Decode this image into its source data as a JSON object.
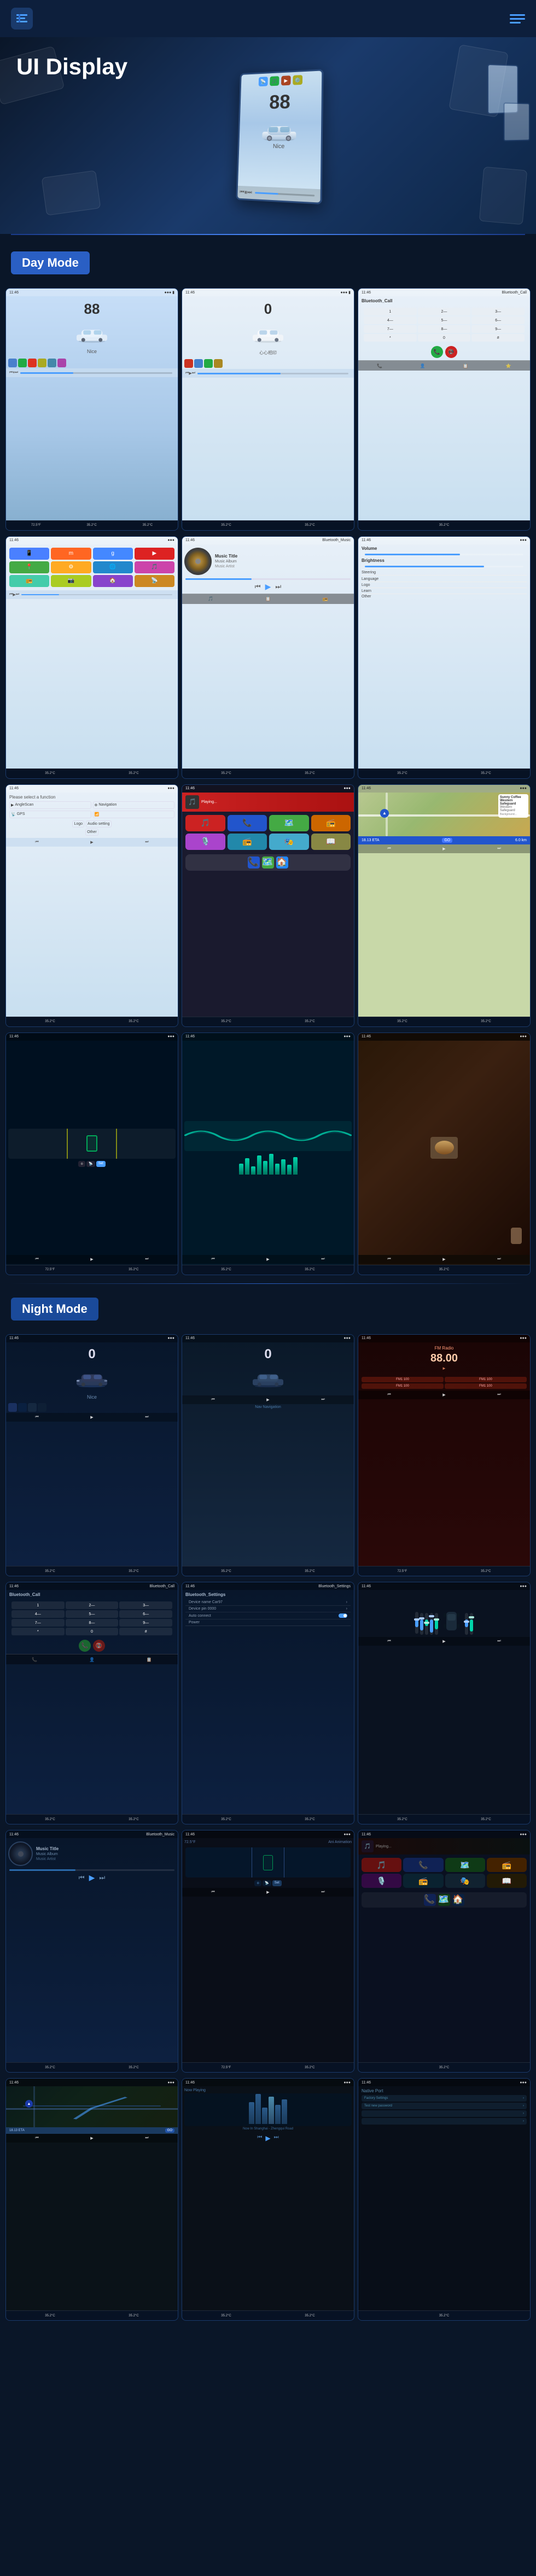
{
  "header": {
    "logo_symbol": "☰",
    "menu_symbol": "≡",
    "title": "UI Display"
  },
  "hero": {
    "title": "UI Display",
    "device_number": "88",
    "device_label": "Nice"
  },
  "day_mode": {
    "badge": "Day Mode",
    "screens": [
      {
        "id": "day-1",
        "type": "main-blue",
        "number": "88",
        "label": "Nice"
      },
      {
        "id": "day-2",
        "type": "main-white",
        "number": "0"
      },
      {
        "id": "day-3",
        "type": "phone-dial"
      },
      {
        "id": "day-4",
        "type": "app-launcher"
      },
      {
        "id": "day-5",
        "type": "music-blue"
      },
      {
        "id": "day-6",
        "type": "settings-panel"
      },
      {
        "id": "day-7",
        "type": "driver-assist"
      },
      {
        "id": "day-8",
        "type": "carplay"
      },
      {
        "id": "day-9",
        "type": "nav-map"
      },
      {
        "id": "day-10",
        "type": "eq-dark"
      },
      {
        "id": "day-11",
        "type": "eq-wave"
      },
      {
        "id": "day-12",
        "type": "video-play"
      }
    ]
  },
  "night_mode": {
    "badge": "Night Mode",
    "screens": [
      {
        "id": "night-1",
        "type": "night-main",
        "number": "0"
      },
      {
        "id": "night-2",
        "type": "night-car"
      },
      {
        "id": "night-3",
        "type": "night-radio",
        "number": "88.00"
      },
      {
        "id": "night-4",
        "type": "night-phone"
      },
      {
        "id": "night-5",
        "type": "night-settings"
      },
      {
        "id": "night-6",
        "type": "night-eq"
      },
      {
        "id": "night-7",
        "type": "night-music"
      },
      {
        "id": "night-8",
        "type": "night-assist"
      },
      {
        "id": "night-9",
        "type": "night-carplay"
      },
      {
        "id": "night-10",
        "type": "night-nav"
      },
      {
        "id": "night-11",
        "type": "night-build"
      },
      {
        "id": "night-12",
        "type": "night-list"
      }
    ]
  },
  "status": {
    "time": "11:46",
    "temp_left": "72.5°F",
    "temp_right": "35.2°C",
    "temp_right2": "35.2°C",
    "signal": "●●●",
    "battery": "▮▮▮"
  },
  "temperatures": {
    "left": "72.5°F",
    "mid": "35.2°C",
    "right": "35.2°C"
  },
  "playback": {
    "play": "▶",
    "pause": "⏸",
    "prev": "⏮",
    "next": "⏭",
    "back": "⏪",
    "forward": "⏩"
  },
  "music": {
    "title": "Music Title",
    "album": "Music Album",
    "artist": "Music Artist"
  },
  "phone": {
    "keys": [
      "1",
      "2—",
      "3—",
      "4—",
      "5—",
      "6—",
      "7—",
      "8—",
      "9—",
      "*",
      "0",
      "#"
    ]
  },
  "settings": {
    "device_name": "Device name  Car97",
    "device_pin": "Device pin  0000",
    "auto_connect": "Auto connect",
    "power": "Power"
  },
  "apps": {
    "icons": [
      "📱",
      "🎵",
      "📻",
      "📍",
      "⚙️",
      "🗺️",
      "☎️",
      "🎬",
      "📡",
      "🔊",
      "📷",
      "🏠"
    ]
  },
  "nav": {
    "destination": "Sunny Coffee Western Safeguard",
    "eta": "18.13 ETA",
    "distance": "6.0 km"
  },
  "eq_heights": [
    20,
    35,
    50,
    40,
    55,
    45,
    60,
    50,
    35,
    45,
    55,
    40,
    30,
    45,
    50
  ],
  "colors": {
    "accent_blue": "#4a9eff",
    "dark_bg": "#0a1628",
    "card_bg": "#0d1f3c",
    "border": "#1a3a6b",
    "day_badge": "#2a5fc4",
    "night_badge": "#1a4a9a",
    "teal": "#00d4aa",
    "red": "#cc2222"
  }
}
